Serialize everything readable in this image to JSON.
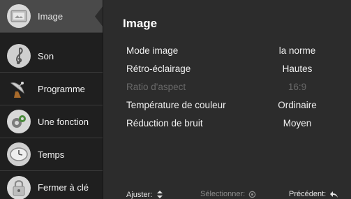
{
  "sidebar": {
    "items": [
      {
        "label": "Image",
        "icon": "image-icon",
        "active": true
      },
      {
        "label": "Son",
        "icon": "music-note-icon"
      },
      {
        "label": "Programme",
        "icon": "satellite-dish-icon"
      },
      {
        "label": "Une fonction",
        "icon": "function-icon"
      },
      {
        "label": "Temps",
        "icon": "clock-icon"
      },
      {
        "label": "Fermer à clé",
        "icon": "lock-icon"
      }
    ]
  },
  "main": {
    "title": "Image",
    "rows": [
      {
        "label": "Mode image",
        "value": "la norme",
        "enabled": true
      },
      {
        "label": "Rétro-éclairage",
        "value": "Hautes",
        "enabled": true
      },
      {
        "label": "Ratio d'aspect",
        "value": "16:9",
        "enabled": false
      },
      {
        "label": "Température de couleur",
        "value": "Ordinaire",
        "enabled": true
      },
      {
        "label": "Réduction de bruit",
        "value": "Moyen",
        "enabled": true
      }
    ]
  },
  "footer": {
    "adjust": "Ajuster:",
    "select": "Sélectionner:",
    "back": "Précédent:"
  },
  "colors": {
    "background": "#2c2c2c",
    "sidebar": "#1f1f1f",
    "active_item": "#4a4a4a",
    "disabled_text": "#6a6a6a"
  }
}
